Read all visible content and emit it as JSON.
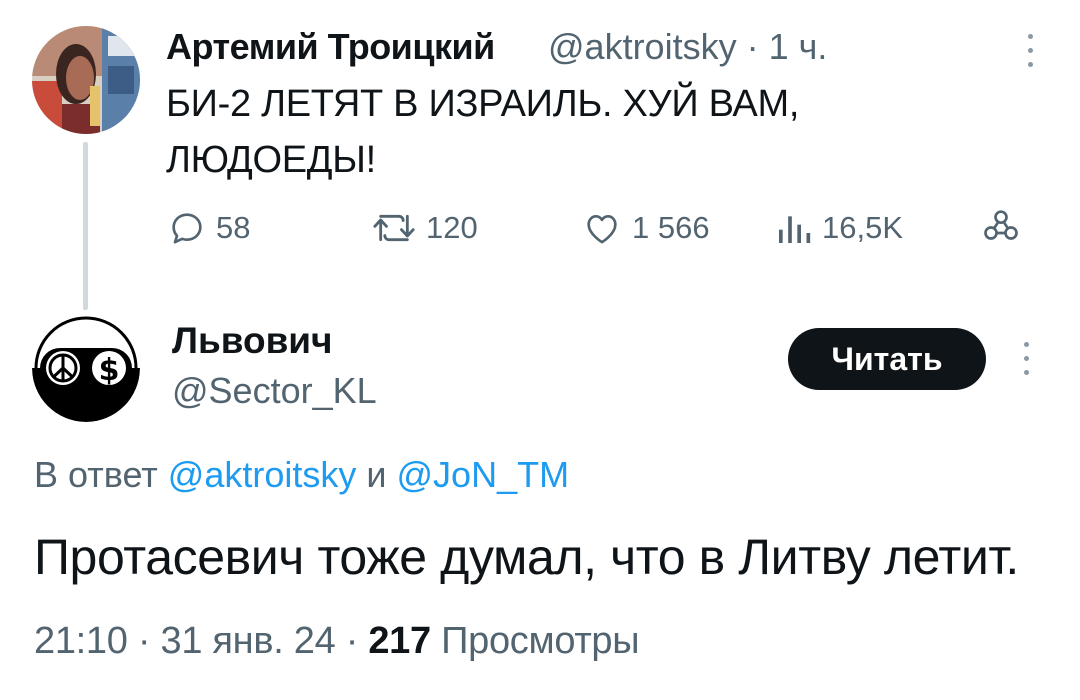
{
  "quoted_tweet": {
    "author_name": "Артемий Троицкий",
    "author_handle": "@aktroitsky",
    "separator": "·",
    "time_ago": "1 ч.",
    "text": "БИ-2 ЛЕТЯТ В ИЗРАИЛЬ. ХУЙ ВАМ, ЛЮДОЕДЫ!",
    "actions": {
      "replies": "58",
      "retweets": "120",
      "likes": "1 566",
      "views": "16,5K"
    }
  },
  "reply_tweet": {
    "author_name": "Львович",
    "author_handle": "@Sector_KL",
    "follow_label": "Читать",
    "reply_to_prefix": "В ответ",
    "reply_to_mentions": [
      "@aktroitsky",
      "@JoN_TM"
    ],
    "reply_to_conjunction": "и",
    "text": "Протасевич тоже думал, что в Литву летит.",
    "meta": {
      "time": "21:10",
      "date": "31 янв. 24",
      "separator": "·",
      "views_count": "217",
      "views_label": "Просмотры"
    }
  },
  "colors": {
    "text_primary": "#0f1419",
    "text_secondary": "#536471",
    "link": "#1d9bf0",
    "thread_line": "#cfd9de",
    "follow_button_bg": "#0f1419"
  },
  "icons": [
    "reply-icon",
    "retweet-icon",
    "like-icon",
    "views-icon",
    "share-icon",
    "more-icon",
    "peace-icon",
    "dollar-icon"
  ]
}
